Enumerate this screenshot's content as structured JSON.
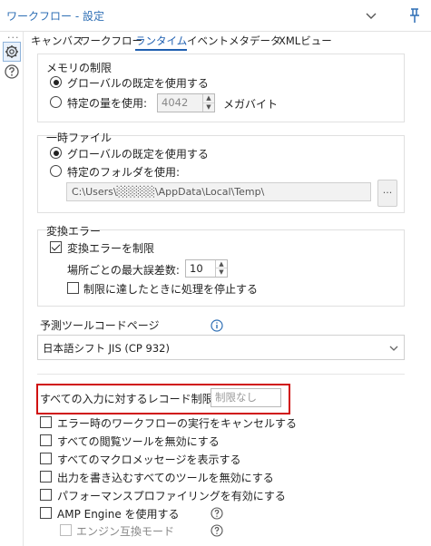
{
  "window": {
    "title": "ワークフロー - 設定"
  },
  "tabs": [
    {
      "label": "キャンバス",
      "active": false
    },
    {
      "label": "ワークフロー",
      "active": false
    },
    {
      "label": "ランタイム",
      "active": true
    },
    {
      "label": "イベント",
      "active": false
    },
    {
      "label": "メタデータ",
      "active": false
    },
    {
      "label": "XMLビュー",
      "active": false
    }
  ],
  "memory": {
    "title": "メモリの制限",
    "option_global": "グローバルの既定を使用する",
    "option_specific": "特定の量を使用:",
    "amount": "4042",
    "unit": "メガバイト",
    "selected": "global"
  },
  "temp": {
    "title": "一時ファイル",
    "option_global": "グローバルの既定を使用する",
    "option_specific": "特定のフォルダを使用:",
    "path": "C:\\Users\\░░░░░\\AppData\\Local\\Temp\\",
    "browse_label": "...",
    "selected": "global"
  },
  "conversion": {
    "title": "変換エラー",
    "limit_label": "変換エラーを制限",
    "limit_checked": true,
    "max_per_field_label": "場所ごとの最大誤差数:",
    "max_per_field": "10",
    "stop_label": "制限に達したときに処理を停止する",
    "stop_checked": false
  },
  "codepage": {
    "label": "予測ツールコードページ",
    "value": "日本語シフト JIS (CP 932)"
  },
  "record_limit": {
    "label": "すべての入力に対するレコード制限:",
    "placeholder": "制限なし",
    "highlight_color": "#d01010"
  },
  "options": [
    {
      "label": "エラー時のワークフローの実行をキャンセルする",
      "checked": false
    },
    {
      "label": "すべての閲覧ツールを無効にする",
      "checked": false
    },
    {
      "label": "すべてのマクロメッセージを表示する",
      "checked": false
    },
    {
      "label": "出力を書き込むすべてのツールを無効にする",
      "checked": false
    },
    {
      "label": "パフォーマンスプロファイリングを有効にする",
      "checked": false
    },
    {
      "label": "AMP Engine を使用する",
      "checked": false
    }
  ],
  "engine_compat": {
    "label": "エンジン互換モード",
    "checked": false,
    "disabled": true
  },
  "icons": {
    "gear": "gear-icon",
    "help": "help-icon",
    "pin": "pin-icon",
    "chevron": "chevron-down-icon",
    "info": "info-icon"
  },
  "colors": {
    "accent": "#1f5fb0",
    "highlight": "#d01010"
  }
}
